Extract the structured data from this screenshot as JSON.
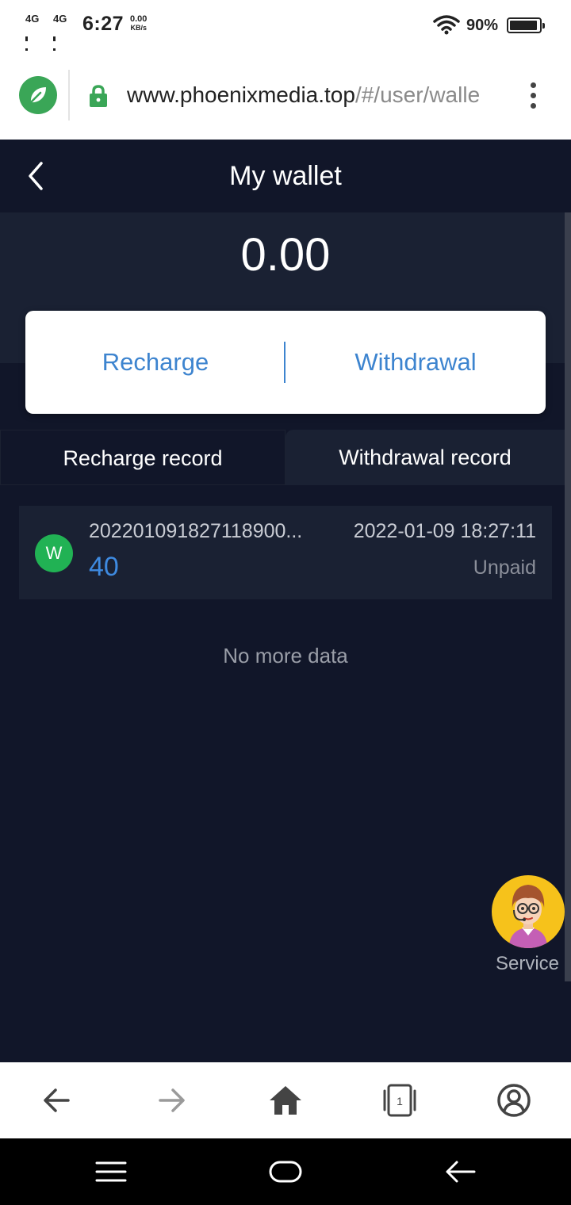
{
  "status_bar": {
    "network_1": "4G",
    "network_2": "4G",
    "time": "6:27",
    "speed_value": "0.00",
    "speed_unit": "KB/s",
    "battery": "90%"
  },
  "browser": {
    "url_host": "www.phoenixmedia.top",
    "url_path": "/#/user/walle",
    "logo_icon": "leaf-icon",
    "lock_color": "#3aa657"
  },
  "header": {
    "title": "My wallet"
  },
  "wallet": {
    "balance": "0.00",
    "recharge_label": "Recharge",
    "withdrawal_label": "Withdrawal"
  },
  "tabs": [
    {
      "label": "Recharge record",
      "active": true
    },
    {
      "label": "Withdrawal record",
      "active": false
    }
  ],
  "records": [
    {
      "avatar_letter": "W",
      "id": "202201091827118900...",
      "amount": "40",
      "time": "2022-01-09 18:27:11",
      "status": "Unpaid"
    }
  ],
  "list_footer": "No more data",
  "service": {
    "label": "Service"
  },
  "colors": {
    "background": "#111629",
    "panel": "#1a2133",
    "accent": "#3d84cf",
    "avatar_green": "#21b254",
    "service_yellow": "#f6c21b"
  }
}
